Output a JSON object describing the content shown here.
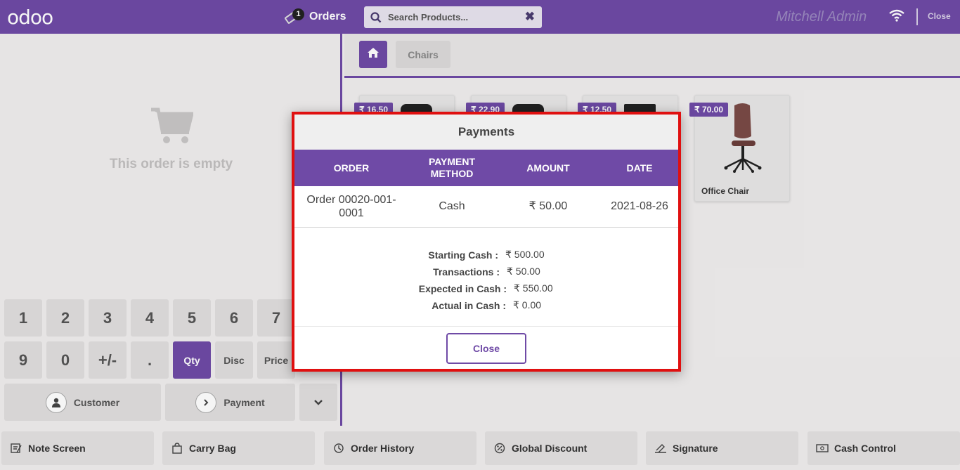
{
  "header": {
    "logo": "odoo",
    "orders_label": "Orders",
    "orders_badge": "1",
    "search_placeholder": "Search Products...",
    "clear_glyph": "✖",
    "user": "Mitchell Admin",
    "close_label": "Close"
  },
  "order": {
    "empty_message": "This order is empty"
  },
  "numpad": {
    "row1": [
      "1",
      "2",
      "3",
      "4",
      "5",
      "6",
      "7"
    ],
    "row2": [
      "9",
      "0",
      "+/-",
      ".",
      "Qty",
      "Disc",
      "Price"
    ],
    "active": "Qty"
  },
  "actions": {
    "customer": "Customer",
    "payment": "Payment"
  },
  "categories": {
    "current": "Chairs"
  },
  "products": [
    {
      "price": "₹ 16.50",
      "name": ""
    },
    {
      "price": "₹ 22.90",
      "name": ""
    },
    {
      "price": "₹ 12.50",
      "name": ""
    },
    {
      "price": "₹ 70.00",
      "name": "Office Chair"
    }
  ],
  "bottom_buttons": [
    {
      "label": "Note Screen",
      "icon": "note-icon"
    },
    {
      "label": "Carry Bag",
      "icon": "bag-icon"
    },
    {
      "label": "Order History",
      "icon": "history-icon"
    },
    {
      "label": "Global Discount",
      "icon": "discount-icon"
    },
    {
      "label": "Signature",
      "icon": "signature-icon"
    },
    {
      "label": "Cash Control",
      "icon": "cash-icon"
    }
  ],
  "modal": {
    "title": "Payments",
    "columns": [
      "ORDER",
      "PAYMENT METHOD",
      "AMOUNT",
      "DATE"
    ],
    "rows": [
      {
        "order": "Order 00020-001-0001",
        "method": "Cash",
        "amount": "₹ 50.00",
        "date": "2021-08-26"
      }
    ],
    "summary": {
      "starting_cash_label": "Starting Cash :",
      "starting_cash": "₹ 500.00",
      "transactions_label": "Transactions :",
      "transactions": "₹ 50.00",
      "expected_label": "Expected in Cash :",
      "expected": "₹ 550.00",
      "actual_label": "Actual in Cash :",
      "actual": "₹ 0.00"
    },
    "close_label": "Close"
  },
  "colors": {
    "brand": "#6f4aa6",
    "highlight_border": "#e01010"
  }
}
